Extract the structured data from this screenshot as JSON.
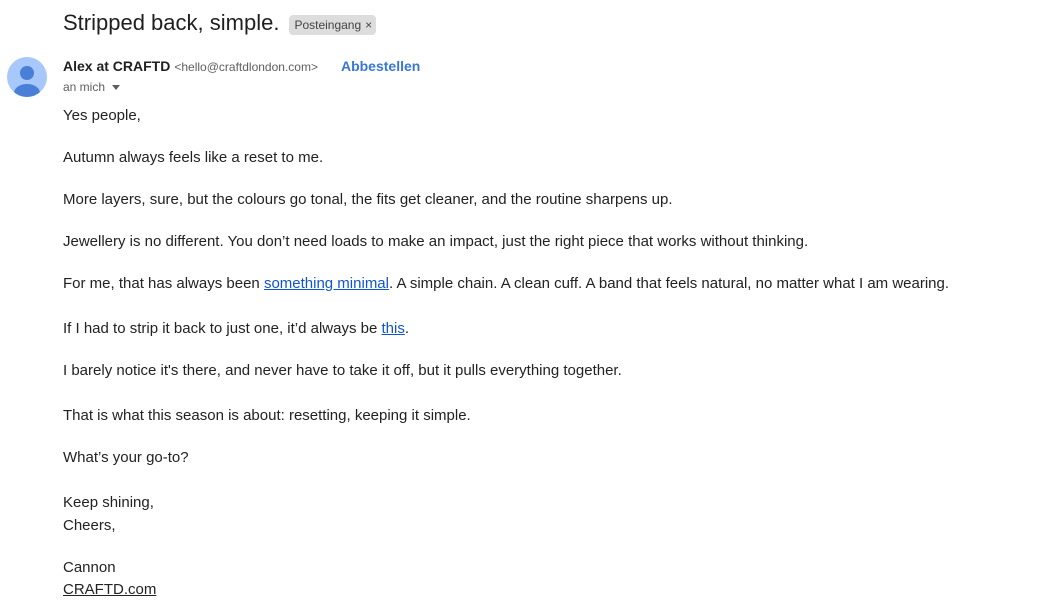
{
  "email": {
    "subject": "Stripped back, simple.",
    "label": "Posteingang",
    "label_remove": "×",
    "sender_name": "Alex at CRAFTD",
    "sender_email": "<hello@craftdlondon.com>",
    "unsubscribe": "Abbestellen",
    "recipient": "an mich"
  },
  "body": {
    "greeting": "Yes people,",
    "p1": "Autumn always feels like a reset to me.",
    "p2": "More layers, sure, but the colours go tonal, the fits get cleaner, and the routine sharpens up.",
    "p3": "Jewellery is no different. You don’t need loads to make an impact, just the right piece that works without thinking.",
    "p4_before": "For me, that has always been ",
    "p4_link": "something minimal",
    "p4_after": ". A simple chain. A clean cuff. A band that feels natural, no matter what I am wearing.",
    "p5_before": "If I had to strip it back to just one, it’d always be ",
    "p5_link": "this",
    "p5_after": ".",
    "p6": "I barely notice it's there, and never have to take it off, but it pulls everything together.",
    "p7": "That is what this season is about: resetting, keeping it simple.",
    "p8": "What’s your go-to?",
    "signoff1": "Keep shining,",
    "signoff2": "Cheers,",
    "signature_name": "Cannon",
    "signature_link": "CRAFTD.com"
  },
  "colors": {
    "link": "#1155cc",
    "unsubscribe": "#3a76d6",
    "avatar_bg": "#a8c7fa",
    "avatar_fg": "#4a7fd8",
    "chip_bg": "#dddddd"
  },
  "icons": {
    "avatar": "person-icon",
    "recipient_caret": "chevron-down-icon",
    "chip_close": "close-icon"
  }
}
